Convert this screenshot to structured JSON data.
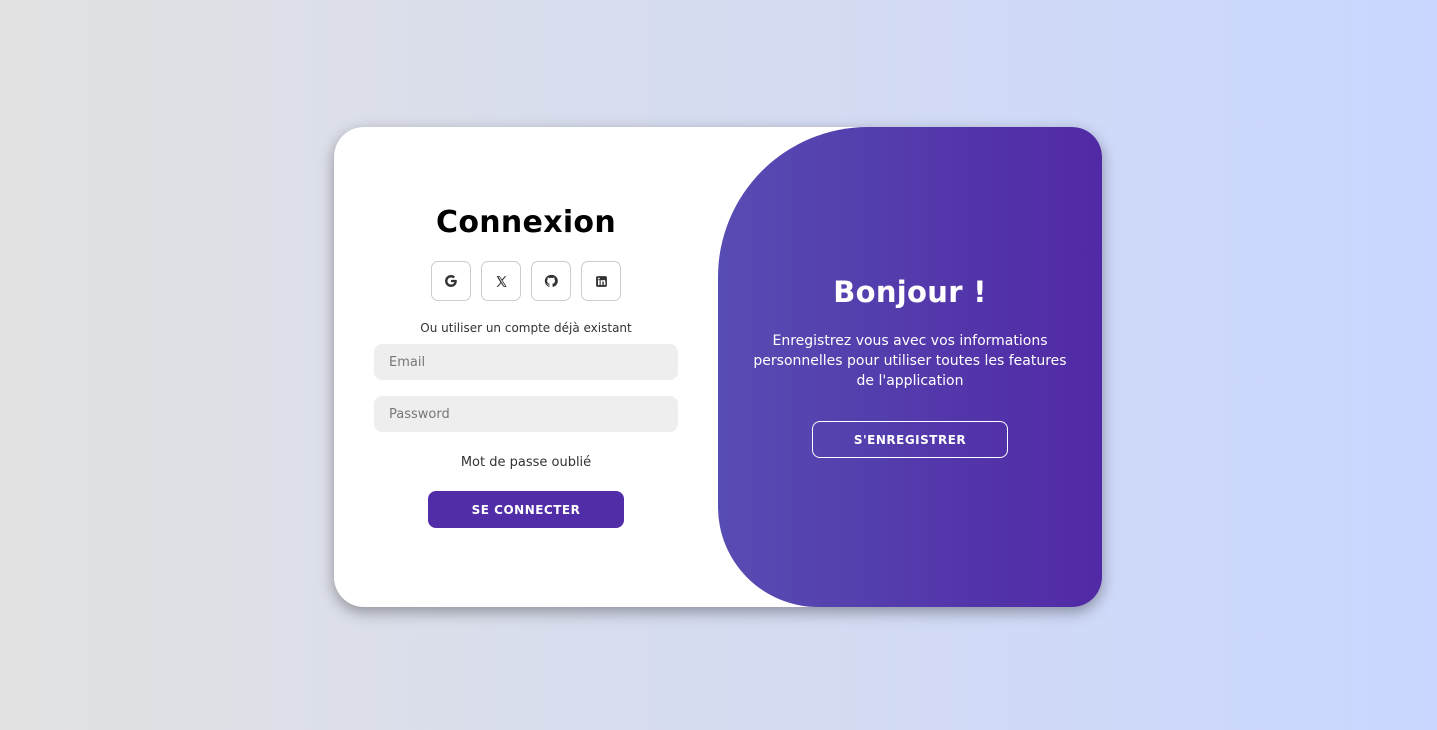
{
  "login": {
    "title": "Connexion",
    "socials": [
      {
        "name": "google-icon",
        "glyph": "G"
      },
      {
        "name": "x-twitter-icon",
        "glyph": "X"
      },
      {
        "name": "github-icon",
        "glyph": "github"
      },
      {
        "name": "linkedin-icon",
        "glyph": "in"
      }
    ],
    "alt_text": "Ou utiliser un compte déjà existant",
    "email_placeholder": "Email",
    "password_placeholder": "Password",
    "forgot_label": "Mot de passe oublié",
    "submit_label": "SE CONNECTER"
  },
  "welcome": {
    "title": "Bonjour !",
    "text": "Enregistrez vous avec vos informations personnelles pour utiliser toutes les features de l'application",
    "register_label": "S'ENREGISTRER"
  },
  "colors": {
    "accent": "#512da8",
    "background_left": "#e2e2e2",
    "background_right": "#c9d6ff"
  }
}
